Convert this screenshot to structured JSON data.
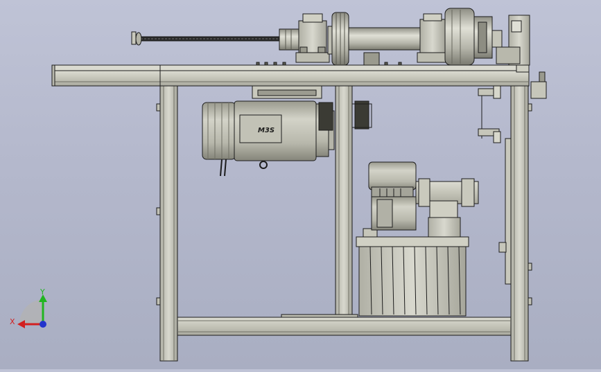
{
  "viewport": {
    "background_top": "#bfc3d6",
    "background_bottom": "#a9aec2",
    "part_fill": "#c9c9bd",
    "part_edge": "#1c1c1c"
  },
  "motor_badge": {
    "label": "M3S"
  },
  "triad": {
    "x_label": "X",
    "y_label": "Y",
    "x_color": "#d22020",
    "y_color": "#21b521",
    "z_color": "#2233cc"
  }
}
